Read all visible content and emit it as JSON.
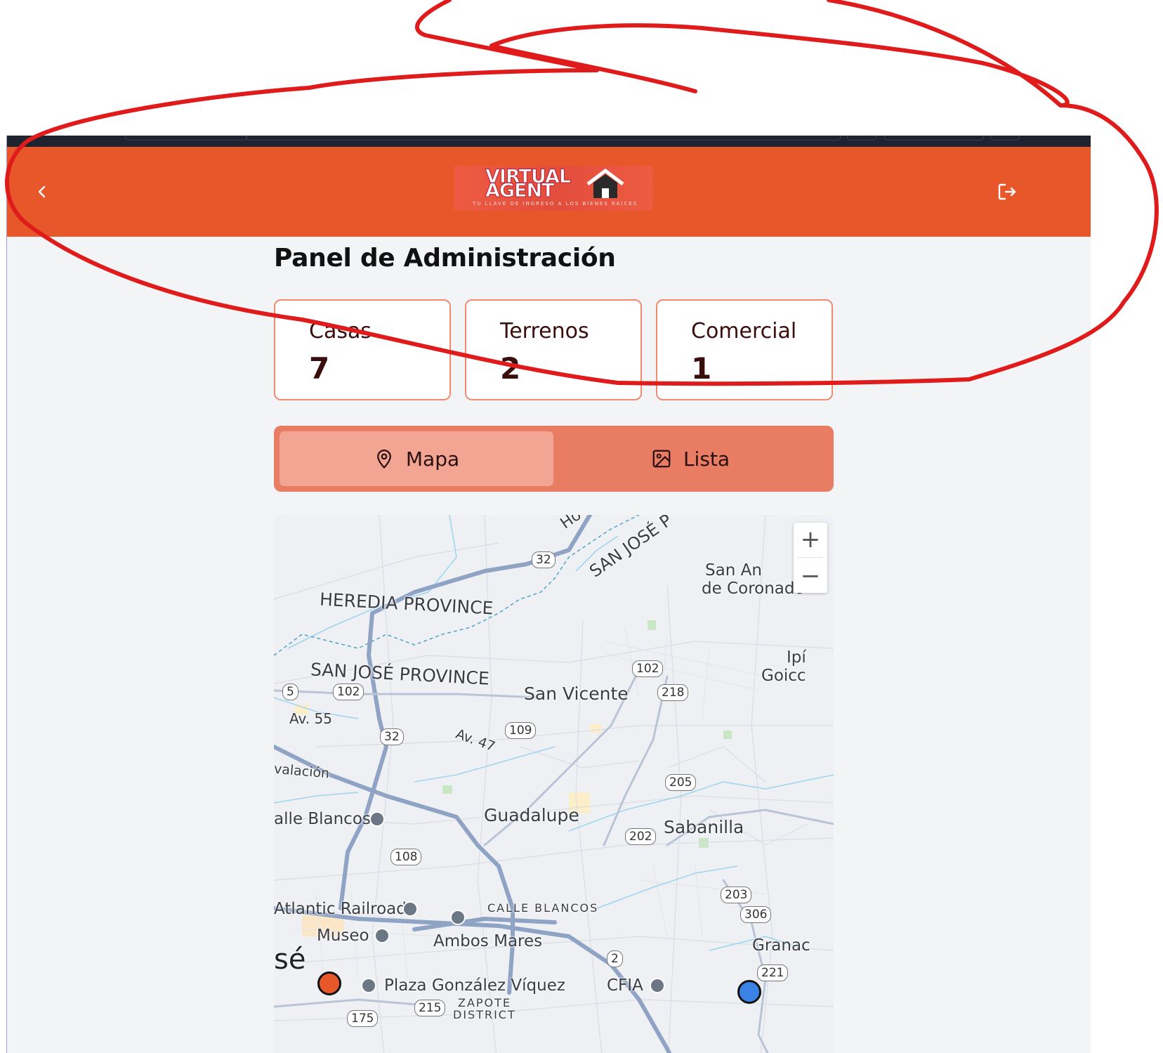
{
  "header": {
    "back_icon": "chevron-left-icon",
    "logout_icon": "logout-icon",
    "logo_line1": "VIRTUAL",
    "logo_line2": "AGENT",
    "logo_tagline": "TU LLAVE DE INGRESO A LOS BIENES RAICES",
    "bg_color": "#e8572a"
  },
  "page_title": "Panel de Administración",
  "stats": [
    {
      "label": "Casas",
      "value": "7"
    },
    {
      "label": "Terrenos",
      "value": "2"
    },
    {
      "label": "Comercial",
      "value": "1"
    }
  ],
  "tabs": [
    {
      "label": "Mapa",
      "icon": "map-pin-icon",
      "active": true
    },
    {
      "label": "Lista",
      "icon": "image-icon",
      "active": false
    }
  ],
  "map": {
    "zoom_in": "+",
    "zoom_out": "−",
    "labels": {
      "heredia": "HEREDIA PROVINCE",
      "sanjose_prov": "SAN JOSÉ PROVINCE",
      "sanjose_top": "SAN JOSÉ P",
      "san_vicente": "San Vicente",
      "guadalupe": "Guadalupe",
      "sabanilla": "Sabanilla",
      "av55": "Av. 55",
      "av47": "Av. 47",
      "valle_blancos": "alle Blancos",
      "atlantic": "Atlantic Railroad",
      "museo": "Museo",
      "ambos_mares": "Ambos Mares",
      "calle_blancos": "CALLE BLANCOS",
      "plaza": "Plaza González Víquez",
      "cfia": "CFIA",
      "zapote": "ZAPOTE",
      "district": "DISTRICT",
      "san_jose_city": "sé",
      "san_antonio": "San An",
      "coronado": "de Coronado",
      "ipis": "Ipí",
      "goico": "Goicc",
      "granad": "Granac",
      "valacion": "valación",
      "ho": "Ho"
    },
    "shields": [
      "32",
      "5",
      "102",
      "32",
      "109",
      "102",
      "218",
      "205",
      "202",
      "108",
      "203",
      "306",
      "2",
      "221",
      "215",
      "175"
    ],
    "markers": [
      {
        "color": "#e8572a"
      },
      {
        "color": "#3b82e6"
      }
    ]
  },
  "annotation_color": "#e01b1b"
}
